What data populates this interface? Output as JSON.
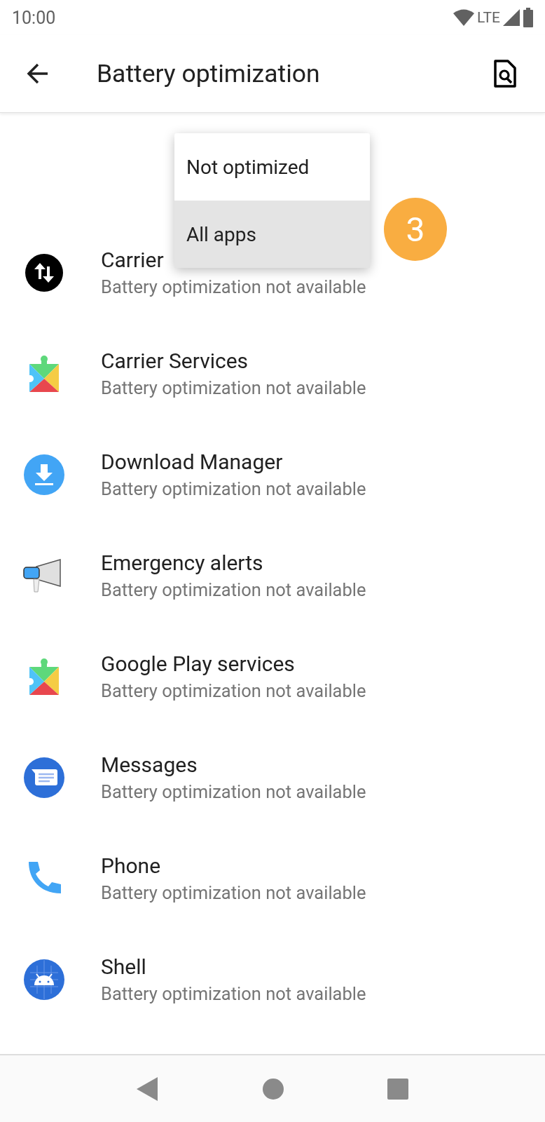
{
  "status_bar": {
    "time": "10:00",
    "network": "LTE"
  },
  "toolbar": {
    "title": "Battery optimization"
  },
  "apps": [
    {
      "kind": "swap",
      "title": "Carrier",
      "subtitle": "Battery optimization not available"
    },
    {
      "kind": "puzzle",
      "title": "Carrier Services",
      "subtitle": "Battery optimization not available"
    },
    {
      "kind": "download",
      "title": "Download Manager",
      "subtitle": "Battery optimization not available"
    },
    {
      "kind": "megaphone",
      "title": "Emergency alerts",
      "subtitle": "Battery optimization not available"
    },
    {
      "kind": "puzzle",
      "title": "Google Play services",
      "subtitle": "Battery optimization not available"
    },
    {
      "kind": "messages",
      "title": "Messages",
      "subtitle": "Battery optimization not available"
    },
    {
      "kind": "phone",
      "title": "Phone",
      "subtitle": "Battery optimization not available"
    },
    {
      "kind": "android",
      "title": "Shell",
      "subtitle": "Battery optimization not available"
    }
  ],
  "menu": {
    "items": [
      {
        "label": "Not optimized",
        "selected": false
      },
      {
        "label": "All apps",
        "selected": true
      }
    ]
  },
  "step_badge": "3"
}
